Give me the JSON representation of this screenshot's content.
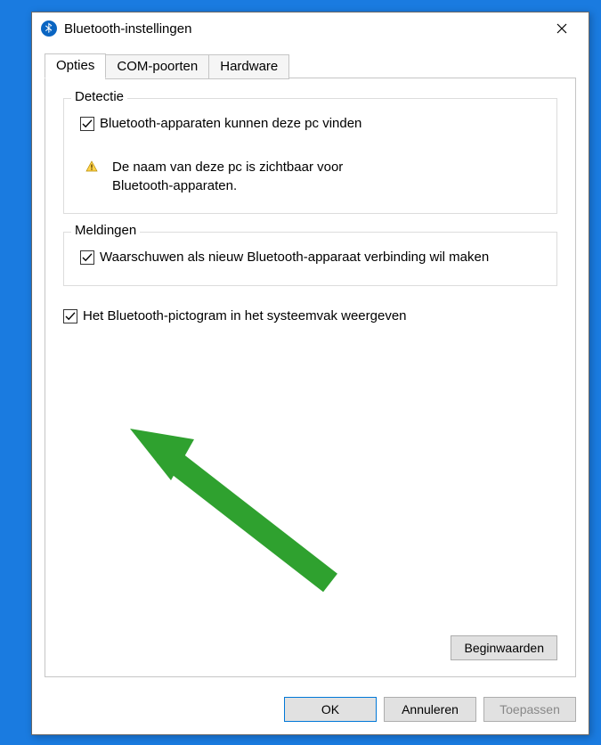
{
  "window": {
    "title": "Bluetooth-instellingen"
  },
  "tabs": {
    "options": "Opties",
    "com": "COM-poorten",
    "hardware": "Hardware"
  },
  "groups": {
    "detection": {
      "title": "Detectie",
      "checkbox_label": "Bluetooth-apparaten kunnen deze pc vinden",
      "info": "De naam van deze pc is zichtbaar voor Bluetooth-apparaten."
    },
    "notifications": {
      "title": "Meldingen",
      "checkbox_label": "Waarschuwen als nieuw Bluetooth-apparaat verbinding wil maken"
    }
  },
  "show_icon_label": "Het Bluetooth-pictogram in het systeemvak weergeven",
  "buttons": {
    "defaults": "Beginwaarden",
    "ok": "OK",
    "cancel": "Annuleren",
    "apply": "Toepassen"
  }
}
